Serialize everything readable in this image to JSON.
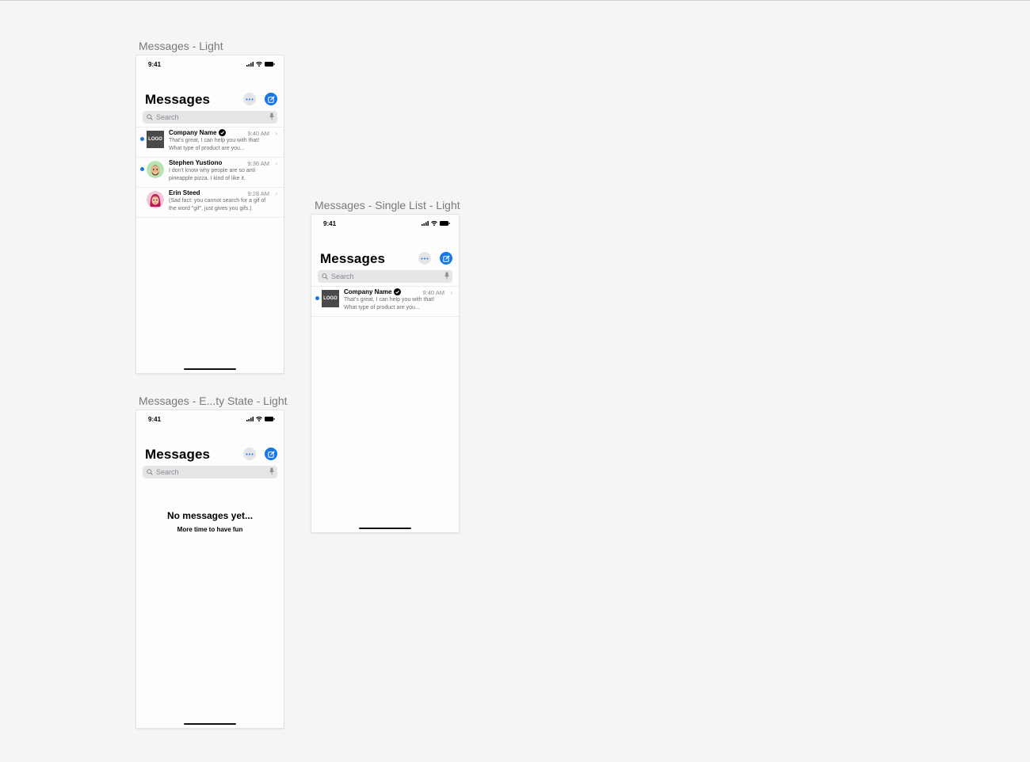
{
  "frames": {
    "light": {
      "label": "Messages - Light"
    },
    "single": {
      "label": "Messages - Single List - Light"
    },
    "empty": {
      "label": "Messages - E...ty State - Light"
    }
  },
  "status": {
    "time": "9:41"
  },
  "header": {
    "title": "Messages"
  },
  "search": {
    "placeholder": "Search"
  },
  "conversations": [
    {
      "name": "Company Name",
      "verified": true,
      "avatar": "logo",
      "avatar_text": "LOGO",
      "time": "9:40 AM",
      "preview": "That's great, I can help you with that! What type of product are you...",
      "unread": true
    },
    {
      "name": "Stephen Yustiono",
      "verified": false,
      "avatar": "memoji-man",
      "time": "9:36 AM",
      "preview": "I don't know why people are so anti pineapple pizza. I kind of like it.",
      "unread": true
    },
    {
      "name": "Erin Steed",
      "verified": false,
      "avatar": "memoji-woman",
      "time": "9:28 AM",
      "preview": "(Sad fact: you cannot search for a gif of the word \"gif\", just gives you gifs.)",
      "unread": false
    }
  ],
  "empty_state": {
    "title": "No messages yet...",
    "subtitle": "More time to have fun"
  },
  "colors": {
    "accent": "#1677e6",
    "background": "#f5f5f5",
    "screen": "#fdfdfd"
  }
}
